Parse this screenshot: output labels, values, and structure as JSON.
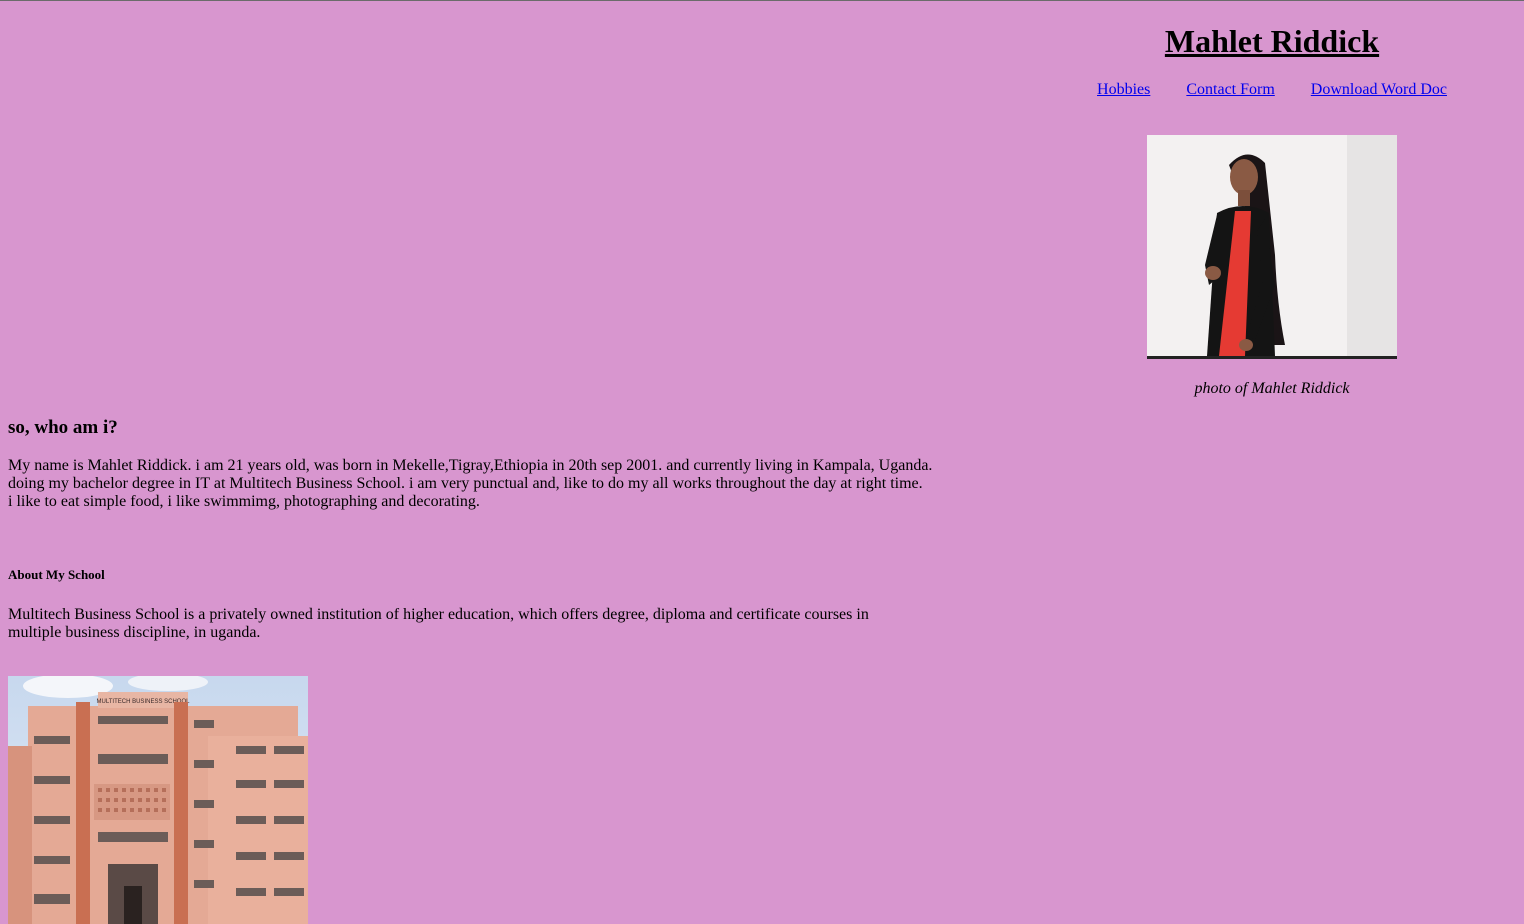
{
  "site": {
    "title": "Mahlet Riddick"
  },
  "nav": {
    "items": [
      {
        "label": "Hobbies"
      },
      {
        "label": "Contact Form"
      },
      {
        "label": "Download Word Doc"
      }
    ]
  },
  "profile": {
    "caption": "photo of Mahlet Riddick"
  },
  "about_me": {
    "heading": "so, who am i?",
    "lines": [
      "My name is Mahlet Riddick. i am 21 years old, was born in Mekelle,Tigray,Ethiopia in 20th sep 2001. and currently living in Kampala, Uganda.",
      "doing my bachelor degree in IT at Multitech Business School. i am very punctual and, like to do my all works throughout the day at right time.",
      "i like to eat simple food, i like swimmimg, photographing and decorating."
    ]
  },
  "school": {
    "heading": "About My School",
    "lines": [
      "Multitech Business School is a privately owned institution of higher education, which offers degree, diploma and certificate courses in",
      "multiple business discipline, in uganda."
    ],
    "building_sign": "MULTITECH BUSINESS SCHOOL"
  },
  "colors": {
    "background": "#d896cf",
    "link": "#0000ee"
  }
}
